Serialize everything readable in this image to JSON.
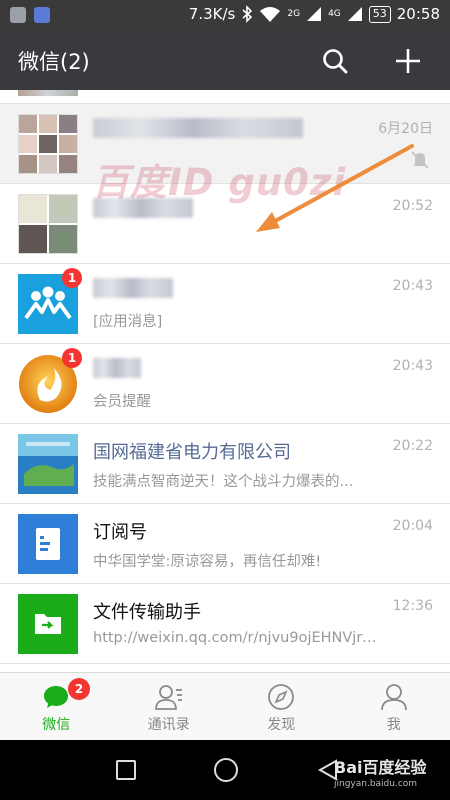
{
  "status_bar": {
    "speed": "7.3K/s",
    "net_a": "2G",
    "net_b": "4G",
    "battery": "53",
    "time": "20:58"
  },
  "header": {
    "title": "微信(2)",
    "search_icon": "search-icon",
    "add_icon": "plus-icon"
  },
  "overlays": {
    "watermark": "百度ID gu0zi"
  },
  "chats": [
    {
      "time": "6月20日",
      "muted": true
    },
    {
      "time": "20:52"
    },
    {
      "preview": "[应用消息]",
      "time": "20:43",
      "badge": "1"
    },
    {
      "preview": "会员提醒",
      "time": "20:43",
      "badge": "1"
    },
    {
      "name": "国网福建省电力有限公司",
      "preview": "技能满点智商逆天！这个战斗力爆表的...",
      "time": "20:22"
    },
    {
      "name": "订阅号",
      "preview": "中华国学堂:原谅容易，再信任却难!",
      "time": "20:04"
    },
    {
      "name": "文件传输助手",
      "preview": "http://weixin.qq.com/r/njvu9ojEHNVjrc...",
      "time": "12:36"
    }
  ],
  "tabs": [
    {
      "label": "微信",
      "badge": "2",
      "icon": "chat-bubble-icon"
    },
    {
      "label": "通讯录",
      "icon": "contacts-icon"
    },
    {
      "label": "发现",
      "icon": "compass-icon"
    },
    {
      "label": "我",
      "icon": "person-icon"
    }
  ],
  "colors": {
    "accent": "#1aad19",
    "header_bg": "#393a3f",
    "badge": "#f43530",
    "link_name": "#576b95"
  },
  "nav_watermark": {
    "brand": "Bai百度经验",
    "url": "jingyan.baidu.com"
  }
}
